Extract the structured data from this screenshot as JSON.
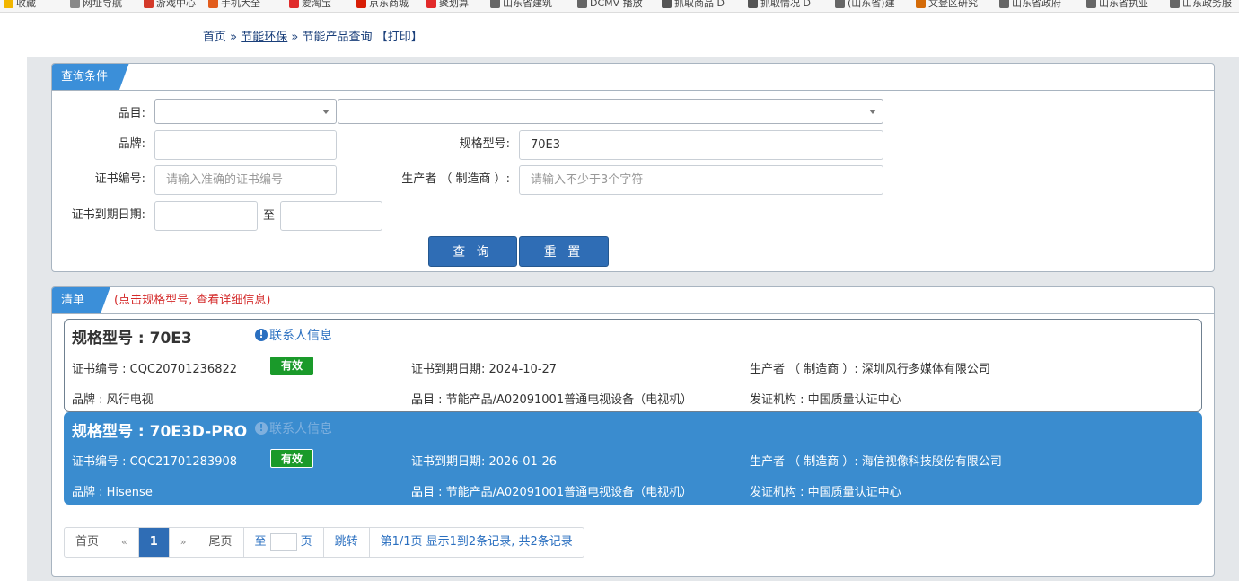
{
  "bookmarks": [
    {
      "label": "收藏",
      "color": "#f2b600"
    },
    {
      "label": "网址导航",
      "color": "#888888"
    },
    {
      "label": "游戏中心",
      "color": "#d43a2a"
    },
    {
      "label": "手机大全",
      "color": "#e25c1c"
    },
    {
      "label": "爱淘宝",
      "color": "#e02b2b"
    },
    {
      "label": "京东商城",
      "color": "#d81e06"
    },
    {
      "label": "聚划算",
      "color": "#e22a2a"
    },
    {
      "label": "山东省建筑",
      "color": "#666666"
    },
    {
      "label": "DCMV 播放",
      "color": "#666666"
    },
    {
      "label": "抓取商品 D",
      "color": "#555555"
    },
    {
      "label": "抓取情况 D",
      "color": "#555555"
    },
    {
      "label": "(山东省)建",
      "color": "#666666"
    },
    {
      "label": "文登区研究",
      "color": "#d46b08"
    },
    {
      "label": "山东省政府",
      "color": "#666666"
    },
    {
      "label": "山东省执业",
      "color": "#666666"
    },
    {
      "label": "山东政务服",
      "color": "#666666"
    }
  ],
  "breadcrumb": {
    "home": "首页",
    "sep": "»",
    "category": "节能环保",
    "current": "节能产品查询",
    "print": "【打印】"
  },
  "query": {
    "title": "查询条件",
    "category_label": "品目:",
    "brand_label": "品牌:",
    "brand_value": "",
    "model_label": "规格型号:",
    "model_value": "70E3",
    "cert_label": "证书编号:",
    "cert_placeholder": "请输入准确的证书编号",
    "maker_label": "生产者 （ 制造商 ）:",
    "maker_placeholder": "请输入不少于3个字符",
    "expiry_label": "证书到期日期:",
    "expiry_to": "至",
    "search_btn": "查 询",
    "reset_btn": "重 置"
  },
  "list": {
    "title": "清单",
    "hint": "(点击规格型号, 查看详细信息)",
    "contact_label": "联系人信息",
    "items": [
      {
        "model": "规格型号 : 70E3",
        "cert": "证书编号 : CQC20701236822",
        "status": "有效",
        "expiry": "证书到期日期: 2024-10-27",
        "maker": "生产者 （ 制造商 ）: 深圳风行多媒体有限公司",
        "brand": "品牌 : 风行电视",
        "category": "品目 : 节能产品/A02091001普通电视设备（电视机）",
        "issuer": "发证机构 : 中国质量认证中心"
      },
      {
        "model": "规格型号 : 70E3D-PRO",
        "cert": "证书编号 : CQC21701283908",
        "status": "有效",
        "expiry": "证书到期日期: 2026-01-26",
        "maker": "生产者 （ 制造商 ）: 海信视像科技股份有限公司",
        "brand": "品牌 : Hisense",
        "category": "品目 : 节能产品/A02091001普通电视设备（电视机）",
        "issuer": "发证机构 : 中国质量认证中心"
      }
    ]
  },
  "pager": {
    "first": "首页",
    "prev": "«",
    "current": "1",
    "next": "»",
    "last": "尾页",
    "goto_prefix": "至",
    "goto_suffix": "页",
    "jump": "跳转",
    "summary": "第1/1页  显示1到2条记录, 共2条记录"
  }
}
